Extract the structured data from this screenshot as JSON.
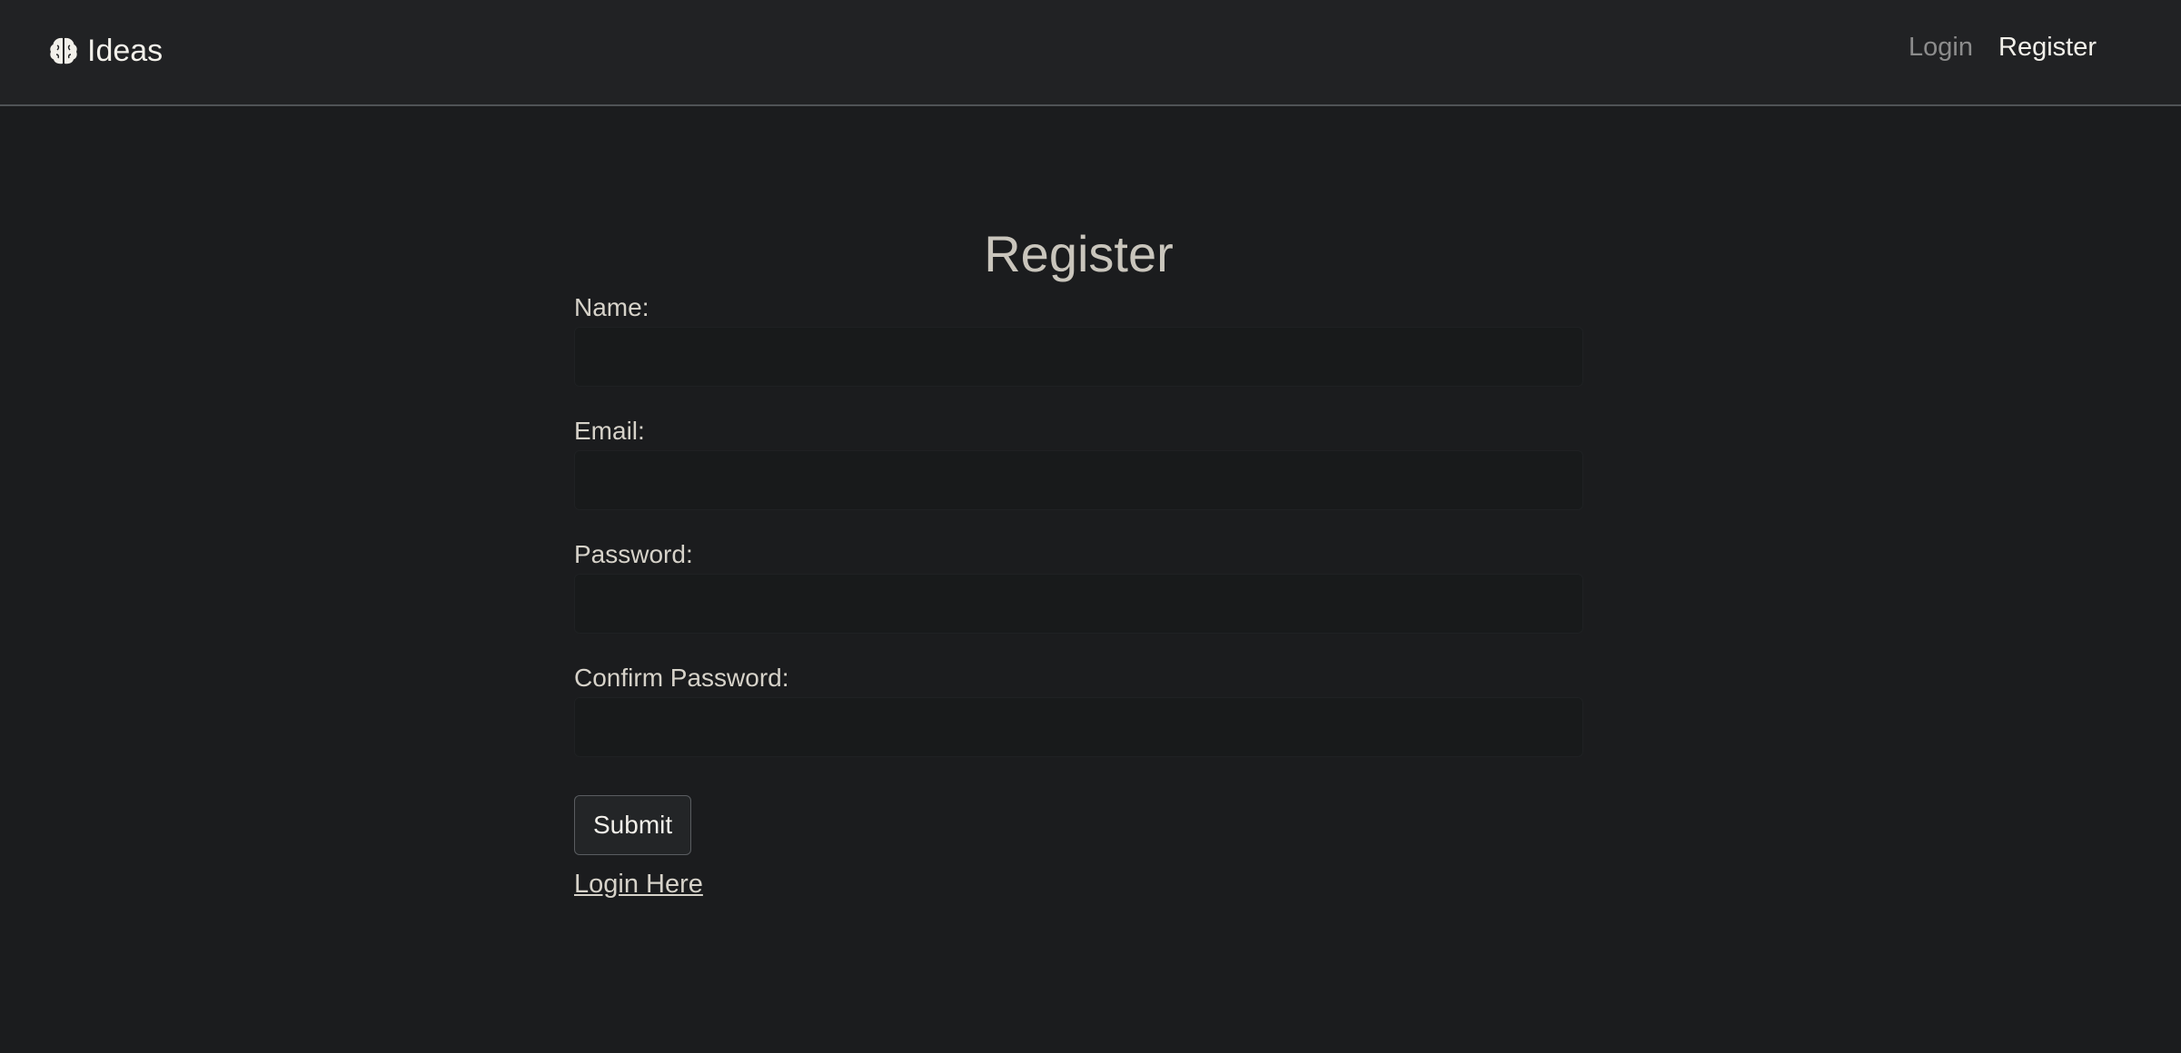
{
  "navbar": {
    "brand_icon": "brain-icon",
    "brand_label": "Ideas",
    "links": [
      {
        "label": "Login",
        "active": false
      },
      {
        "label": "Register",
        "active": true
      }
    ]
  },
  "form": {
    "title": "Register",
    "fields": [
      {
        "label": "Name:",
        "value": "",
        "placeholder": ""
      },
      {
        "label": "Email:",
        "value": "",
        "placeholder": ""
      },
      {
        "label": "Password:",
        "value": "",
        "placeholder": ""
      },
      {
        "label": "Confirm Password:",
        "value": "",
        "placeholder": ""
      }
    ],
    "submit_label": "Submit",
    "login_link_label": "Login Here"
  },
  "colors": {
    "background": "#1b1c1e",
    "navbar": "#212224",
    "text": "#d6d2c9"
  }
}
